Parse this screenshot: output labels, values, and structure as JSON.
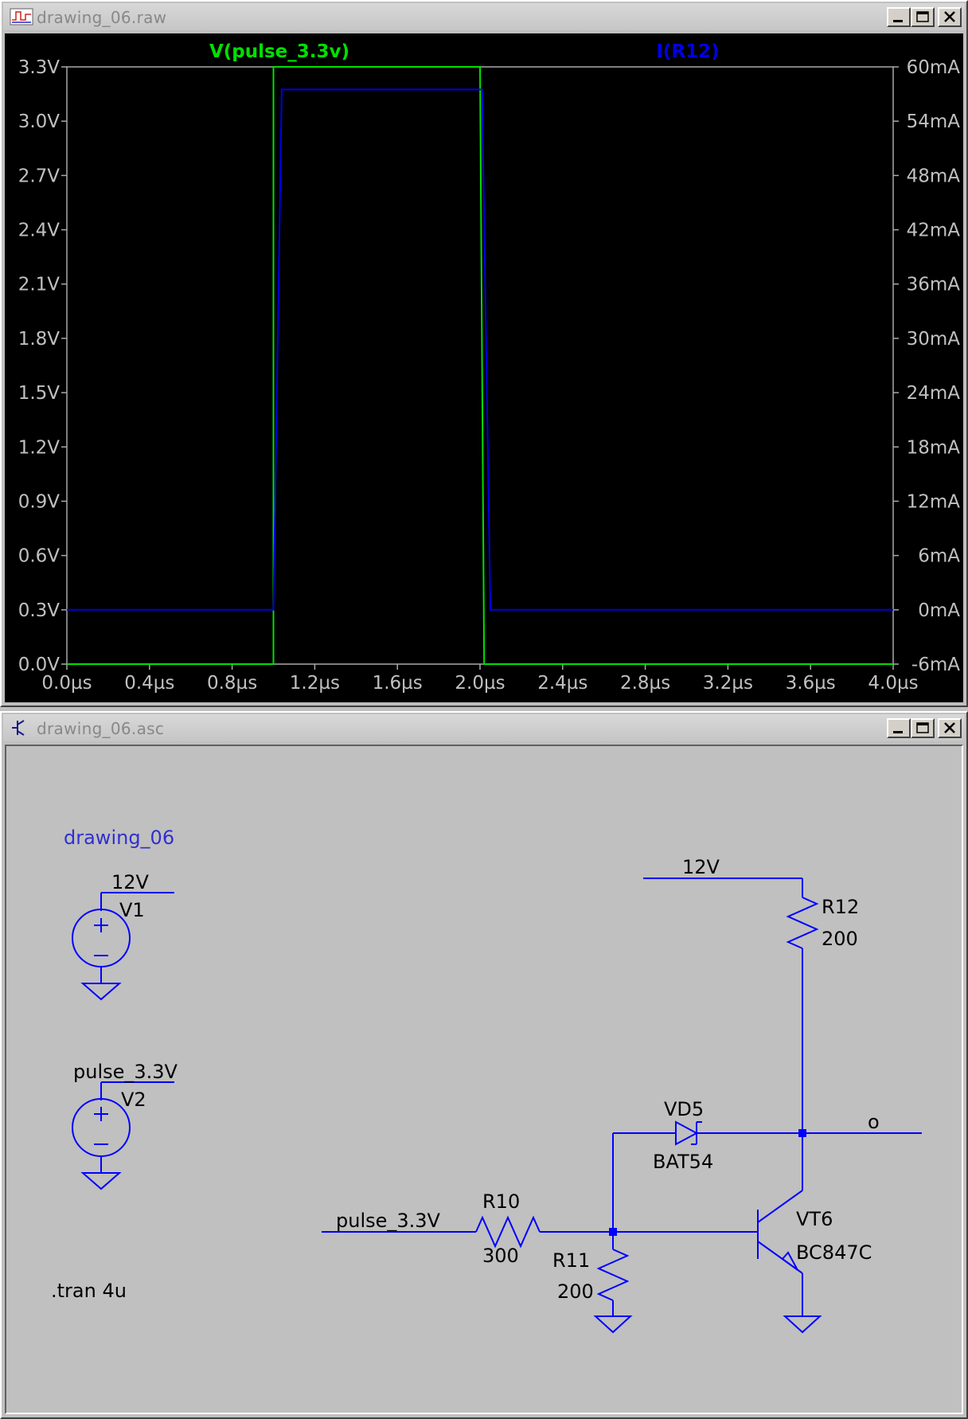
{
  "waveform_window": {
    "title": "drawing_06.raw",
    "icon": "waveform-icon",
    "buttons": {
      "minimize": "minimize-icon",
      "maximize": "maximize-icon",
      "close": "close-icon"
    }
  },
  "schematic_window": {
    "title": "drawing_06.asc",
    "icon": "schematic-icon",
    "buttons": {
      "minimize": "minimize-icon",
      "maximize": "maximize-icon",
      "close": "close-icon"
    }
  },
  "chart_data": {
    "type": "line",
    "xlabel": "",
    "x_ticks": [
      "0.0µs",
      "0.4µs",
      "0.8µs",
      "1.2µs",
      "1.6µs",
      "2.0µs",
      "2.4µs",
      "2.8µs",
      "3.2µs",
      "3.6µs",
      "4.0µs"
    ],
    "y_left_ticks": [
      "0.0V",
      "0.3V",
      "0.6V",
      "0.9V",
      "1.2V",
      "1.5V",
      "1.8V",
      "2.1V",
      "2.4V",
      "2.7V",
      "3.0V",
      "3.3V"
    ],
    "y_right_ticks": [
      "-6mA",
      "0mA",
      "6mA",
      "12mA",
      "18mA",
      "24mA",
      "30mA",
      "36mA",
      "42mA",
      "48mA",
      "54mA",
      "60mA"
    ],
    "xlim": [
      0,
      4
    ],
    "ylim_left": [
      0,
      3.3
    ],
    "ylim_right": [
      -6,
      60
    ],
    "grid": false,
    "background": "#000000",
    "series": [
      {
        "name": "V(pulse_3.3v)",
        "axis": "left",
        "color": "#00e000",
        "x": [
          0,
          1.0,
          1.0,
          2.0,
          2.02,
          4.0
        ],
        "y": [
          0,
          0,
          3.3,
          3.3,
          0,
          0
        ]
      },
      {
        "name": "I(R12)",
        "axis": "right",
        "color": "#0000e6",
        "x": [
          0,
          1.0,
          1.04,
          2.01,
          2.05,
          4.0
        ],
        "y": [
          0,
          0,
          57.5,
          57.5,
          0,
          0
        ]
      }
    ]
  },
  "schematic": {
    "wire_color": "#0000ff",
    "text_color": "#000000",
    "title_color": "#3030d0",
    "title": "drawing_06",
    "directive": ".tran 4u",
    "v1": {
      "name": "V1",
      "net": "12V"
    },
    "v2": {
      "name": "V2",
      "net": "pulse_3.3V"
    },
    "net_12v": "12V",
    "net_pulse": "pulse_3.3V",
    "net_out": "o",
    "r12": {
      "name": "R12",
      "value": "200"
    },
    "r10": {
      "name": "R10",
      "value": "300"
    },
    "r11": {
      "name": "R11",
      "value": "200"
    },
    "vd5": {
      "name": "VD5",
      "value": "BAT54"
    },
    "vt6": {
      "name": "VT6",
      "value": "BC847C"
    }
  }
}
